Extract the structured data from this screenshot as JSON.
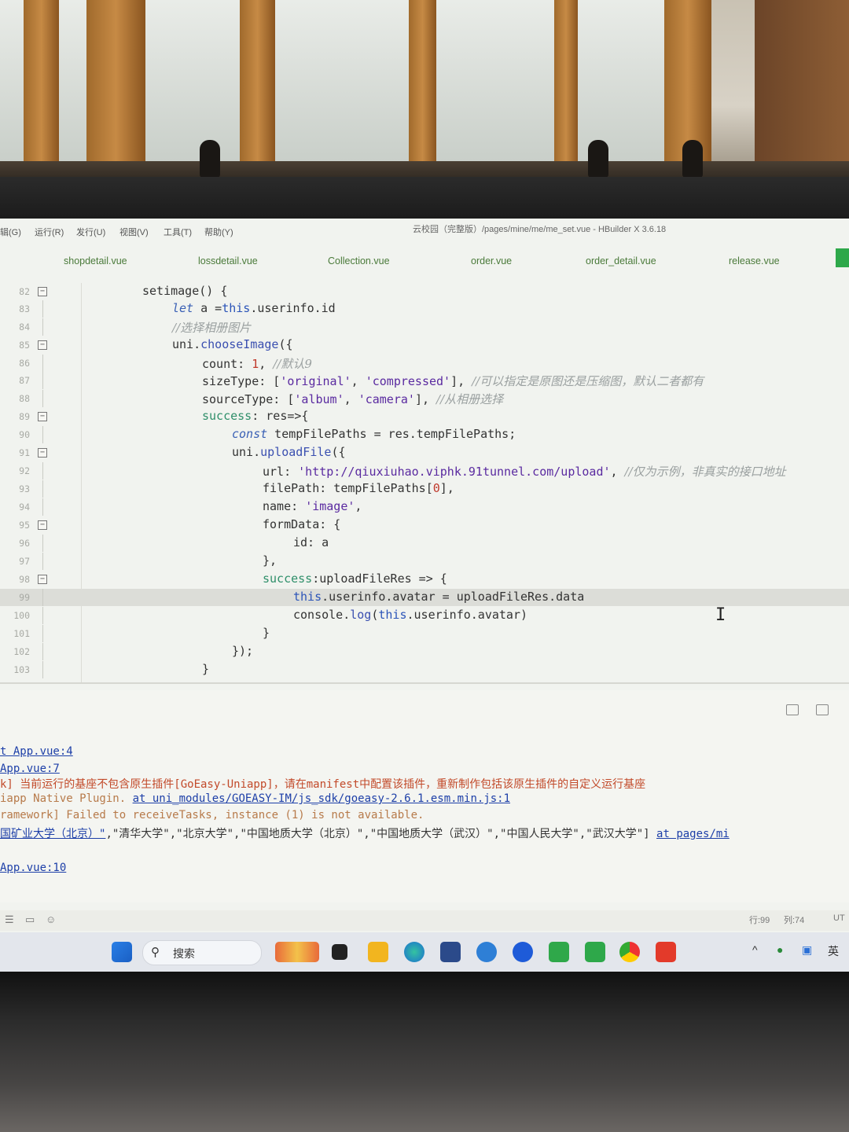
{
  "menu": {
    "items": [
      "辑(G)",
      "运行(R)",
      "发行(U)",
      "视图(V)",
      "工具(T)",
      "帮助(Y)"
    ],
    "window_title": "云校园（完整版）/pages/mine/me/me_set.vue - HBuilder X 3.6.18"
  },
  "tabs": [
    "shopdetail.vue",
    "lossdetail.vue",
    "Collection.vue",
    "order.vue",
    "order_detail.vue",
    "release.vue"
  ],
  "editor": {
    "line_numbers": [
      "82",
      "83",
      "84",
      "85",
      "86",
      "87",
      "88",
      "89",
      "90",
      "91",
      "92",
      "93",
      "94",
      "95",
      "96",
      "97",
      "98",
      "99",
      "100",
      "101",
      "102",
      "103"
    ],
    "highlighted_line": "99",
    "code": {
      "l82": "setimage() {",
      "l83_kw": "let",
      "l83_rest": " a =",
      "l83_this": "this",
      "l83_tail": ".userinfo.id",
      "l84_cm": "//选择相册图片",
      "l85_a": "uni.",
      "l85_fn": "chooseImage",
      "l85_b": "({",
      "l86_a": "count: ",
      "l86_num": "1",
      "l86_b": ", ",
      "l86_cm": "//默认9",
      "l87_a": "sizeType: [",
      "l87_s1": "'original'",
      "l87_b": ", ",
      "l87_s2": "'compressed'",
      "l87_c": "], ",
      "l87_cm": "//可以指定是原图还是压缩图，默认二者都有",
      "l88_a": "sourceType: [",
      "l88_s1": "'album'",
      "l88_b": ", ",
      "l88_s2": "'camera'",
      "l88_c": "], ",
      "l88_cm": "//从相册选择",
      "l89_kw": "success",
      "l89_b": ": res=>{",
      "l90_kw": "const",
      "l90_b": " tempFilePaths = res.tempFilePaths;",
      "l91_a": "uni.",
      "l91_fn": "uploadFile",
      "l91_b": "({",
      "l92_a": "url: ",
      "l92_s": "'http://qiuxiuhao.viphk.91tunnel.com/upload'",
      "l92_b": ", ",
      "l92_cm": "//仅为示例，非真实的接口地址",
      "l93_a": "filePath: tempFilePaths[",
      "l93_num": "0",
      "l93_b": "],",
      "l94_a": "name: ",
      "l94_s": "'image'",
      "l94_b": ",",
      "l95": "formData: {",
      "l96": "id: a",
      "l97": "},",
      "l98_kw": "success",
      "l98_b": ":uploadFileRes => {",
      "l99_this": "this",
      "l99_b": ".userinfo.avatar = uploadFileRes.data",
      "l100_a": "console.",
      "l100_fn": "log",
      "l100_b": "(",
      "l100_this": "this",
      "l100_c": ".userinfo.avatar)",
      "l101": "}",
      "l102": "});",
      "l103": "}"
    }
  },
  "console": {
    "line1": "t App.vue:4",
    "line2": "App.vue:7",
    "line3": "k] 当前运行的基座不包含原生插件[GoEasy-Uniapp]，请在manifest中配置该插件，重新制作包括该原生插件的自定义运行基座",
    "line4_a": "iapp Native Plugin. ",
    "line4_link": "at uni_modules/GOEASY-IM/js_sdk/goeasy-2.6.1.esm.min.js:1",
    "line5": "ramework] Failed to receiveTasks, instance (1) is not available.",
    "line6_link_a": "国矿业大学（北京）\"",
    "line6_b": ",\"清华大学\",\"北京大学\",\"中国地质大学（北京）\",\"中国地质大学（武汉）\",\"中国人民大学\",\"武汉大学\"]",
    "line6_link_b": "at pages/mi",
    "line7": "App.vue:10"
  },
  "statusbar": {
    "row": "行:99",
    "col": "列:74",
    "encoding": "UT"
  },
  "taskbar": {
    "search_label": "搜索",
    "lang": "英"
  },
  "colors": {
    "accent_green": "#2ea84a",
    "keyword": "#3a60b5",
    "link": "#1d3fa8"
  }
}
